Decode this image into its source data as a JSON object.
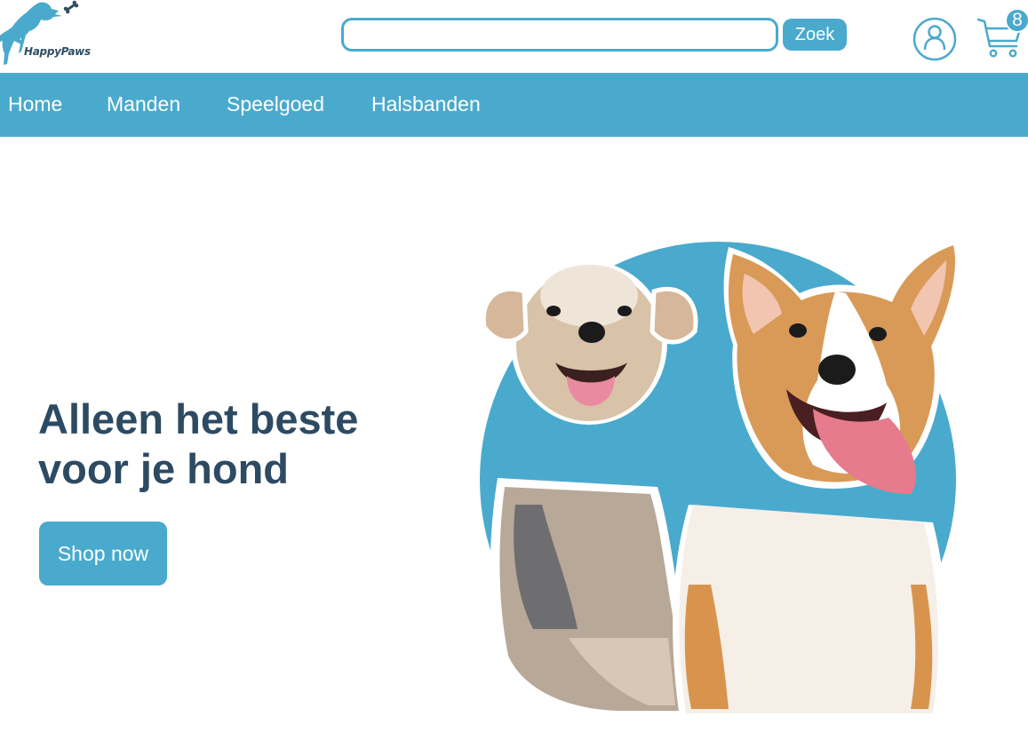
{
  "brand": {
    "name": "HappyPaws",
    "color": "#4aaacd",
    "text_color": "#2f4e63"
  },
  "search": {
    "value": "",
    "placeholder": "",
    "button_label": "Zoek"
  },
  "header": {
    "account_icon": "user-circle-icon",
    "cart_icon": "shopping-cart-icon",
    "cart_count": "8"
  },
  "nav": {
    "items": [
      "Home",
      "Manden",
      "Speelgoed",
      "Halsbanden"
    ]
  },
  "hero": {
    "title_line1": "Alleen het beste",
    "title_line2": "voor je hond",
    "button_label": "Shop now",
    "image": "two-happy-dogs-yorkie-and-corgi",
    "heading_color": "#2d4a63"
  }
}
